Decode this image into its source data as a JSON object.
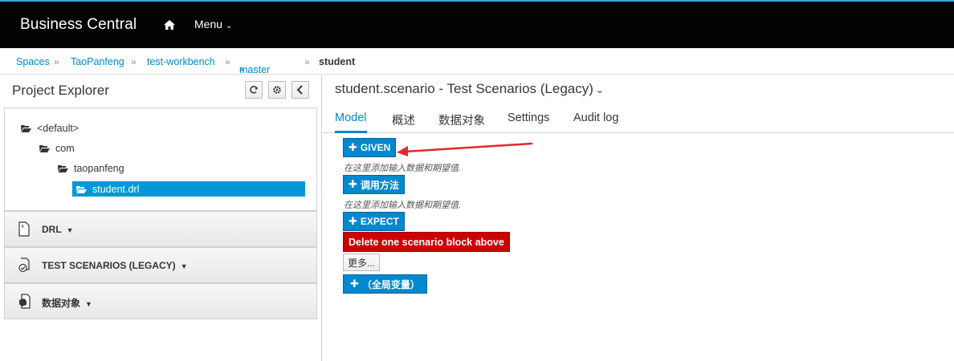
{
  "app": {
    "title": "Business Central",
    "menu_label": "Menu"
  },
  "breadcrumb": {
    "items": [
      "Spaces",
      "TaoPanfeng",
      "test-workbench"
    ],
    "branch": "master",
    "current": "student"
  },
  "explorer": {
    "title": "Project Explorer",
    "tree": [
      "<default>",
      "com",
      "taopanfeng",
      "student.drl"
    ],
    "sections": [
      "DRL",
      "TEST SCENARIOS (LEGACY)",
      "数据对象"
    ]
  },
  "editor": {
    "title": "student.scenario - Test Scenarios (Legacy)",
    "tabs": [
      "Model",
      "概述",
      "数据对象",
      "Settings",
      "Audit log"
    ],
    "given_label": "GIVEN",
    "given_hint": "在这里添加输入数据和期望值.",
    "call_label": "调用方法",
    "call_hint": "在这里添加输入数据和期望值.",
    "expect_label": "EXPECT",
    "delete_label": "Delete one scenario block above",
    "more_label": "更多...",
    "globals_label": "（全局变量）"
  },
  "colors": {
    "accent": "#0088ce",
    "danger": "#cc0000",
    "selected": "#0099d3",
    "annotation": "#e8262d"
  }
}
